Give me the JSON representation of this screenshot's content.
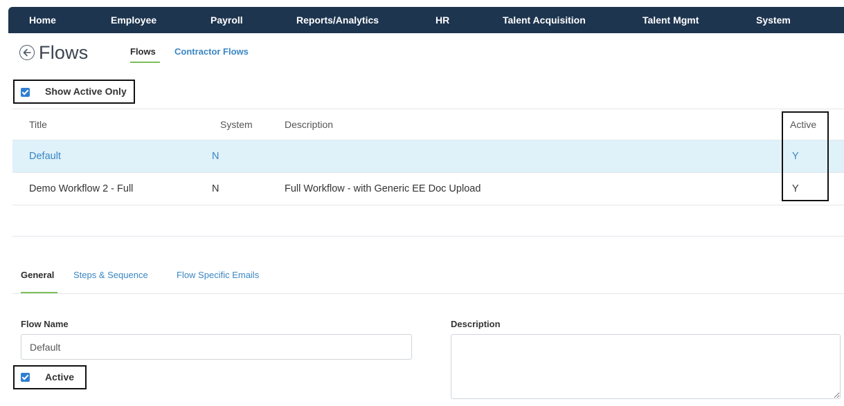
{
  "nav": {
    "items": [
      {
        "label": "Home"
      },
      {
        "label": "Employee"
      },
      {
        "label": "Payroll"
      },
      {
        "label": "Reports/Analytics"
      },
      {
        "label": "HR"
      },
      {
        "label": "Talent Acquisition"
      },
      {
        "label": "Talent Mgmt"
      },
      {
        "label": "System"
      }
    ],
    "background": "#1e3550"
  },
  "page": {
    "title": "Flows",
    "back_icon": "circle-arrow-left-icon"
  },
  "subtabs": [
    {
      "label": "Flows",
      "active": true
    },
    {
      "label": "Contractor Flows",
      "active": false
    }
  ],
  "filter": {
    "show_active_only_label": "Show Active Only",
    "show_active_only_checked": true
  },
  "table": {
    "columns": [
      "Title",
      "System",
      "Description",
      "Active"
    ],
    "rows": [
      {
        "title": "Default",
        "system": "N",
        "description": "",
        "active": "Y",
        "selected": true
      },
      {
        "title": "Demo Workflow 2 - Full",
        "system": "N",
        "description": "Full Workflow - with Generic EE Doc Upload",
        "active": "Y",
        "selected": false
      }
    ]
  },
  "detail_tabs": [
    {
      "label": "General",
      "active": true
    },
    {
      "label": "Steps & Sequence",
      "active": false
    },
    {
      "label": "Flow Specific Emails",
      "active": false
    }
  ],
  "form": {
    "flow_name_label": "Flow Name",
    "flow_name_value": "Default",
    "description_label": "Description",
    "description_value": "",
    "active_label": "Active",
    "active_checked": true
  },
  "colors": {
    "accent": "#3a86c4",
    "checkbox": "#2f7fd1",
    "tab_underline": "#7bbf5a",
    "selected_row": "#dff1f9"
  }
}
